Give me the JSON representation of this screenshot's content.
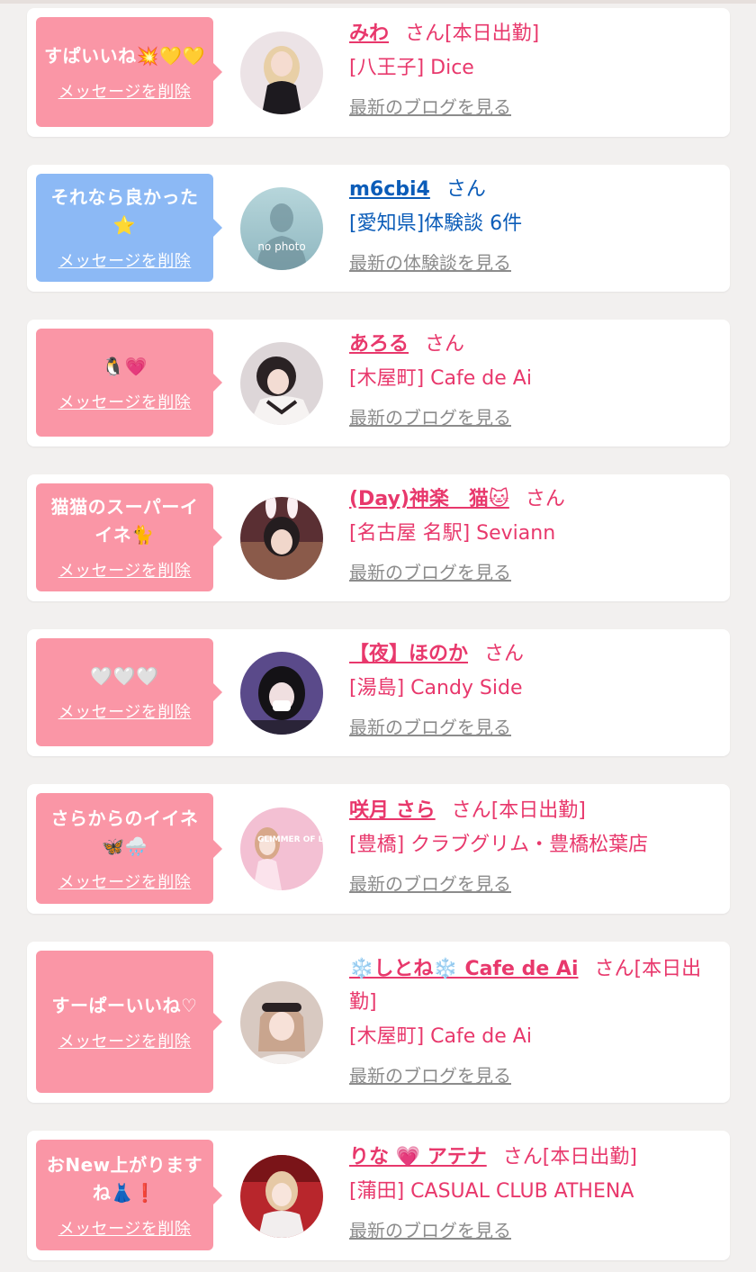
{
  "entries": [
    {
      "message": "すぱいいね💥💛💛",
      "delete_label": "メッセージを削除",
      "name": "みわ",
      "honorific": "さん",
      "status": "[本日出勤]",
      "shop": "[八王子] Dice",
      "blog_link": "最新のブログを見る",
      "bubble_color": "#fa96a6",
      "avatar_bg": "#e9d6dc"
    },
    {
      "message": "それなら良かった⭐",
      "delete_label": "メッセージを削除",
      "name": "m6cbi4",
      "honorific": "さん",
      "status": "",
      "shop": "[愛知県]体験談 6件",
      "blog_link": "最新の体験談を見る",
      "avatar_text": "no photo",
      "bubble_color": "#8cb9f5",
      "avatar_bg": "#9fc7cf"
    },
    {
      "message": "🐧💗",
      "delete_label": "メッセージを削除",
      "name": "あろる",
      "honorific": "さん",
      "status": "",
      "shop": "[木屋町] Cafe de Ai",
      "blog_link": "最新のブログを見る",
      "bubble_color": "#fa96a6",
      "avatar_bg": "#c9c1c4"
    },
    {
      "message": "猫猫のスーパーイイネ🐈",
      "delete_label": "メッセージを削除",
      "name": "(Day)神楽　猫🐱",
      "honorific": "さん",
      "status": "",
      "shop": "[名古屋 名駅] Seviann",
      "blog_link": "最新のブログを見る",
      "bubble_color": "#fa96a6",
      "avatar_bg": "#6a3a3c"
    },
    {
      "message": "🤍🤍🤍",
      "delete_label": "メッセージを削除",
      "name": "【夜】ほのか",
      "honorific": "さん",
      "status": "",
      "shop": "[湯島] Candy Side",
      "blog_link": "最新のブログを見る",
      "bubble_color": "#fa96a6",
      "avatar_bg": "#5b4a8a"
    },
    {
      "message": "さらからのイイネ🦋🌧️",
      "delete_label": "メッセージを削除",
      "name": "咲月 さら",
      "honorific": "さん",
      "status": "[本日出勤]",
      "shop": "[豊橋] クラブグリム・豊橋松葉店",
      "blog_link": "最新のブログを見る",
      "avatar_text": "GLIMMER OF LIGHT",
      "bubble_color": "#fa96a6",
      "avatar_bg": "#f2b7cd"
    },
    {
      "message": "すーぱーいいね♡",
      "delete_label": "メッセージを削除",
      "name": "❄️しとね❄️ Cafe de Ai",
      "honorific": "さん",
      "status": "[本日出勤]",
      "shop": "[木屋町] Cafe de Ai",
      "blog_link": "最新のブログを見る",
      "bubble_color": "#fa96a6",
      "avatar_bg": "#d9c7bd"
    },
    {
      "message": "おNew上がりますね👗❗",
      "delete_label": "メッセージを削除",
      "name": "りな 💗 アテナ",
      "honorific": "さん",
      "status": "[本日出勤]",
      "shop": "[蒲田] CASUAL CLUB ATHENA",
      "blog_link": "最新のブログを見る",
      "bubble_color": "#fa96a6",
      "avatar_bg": "#b8262c"
    }
  ]
}
